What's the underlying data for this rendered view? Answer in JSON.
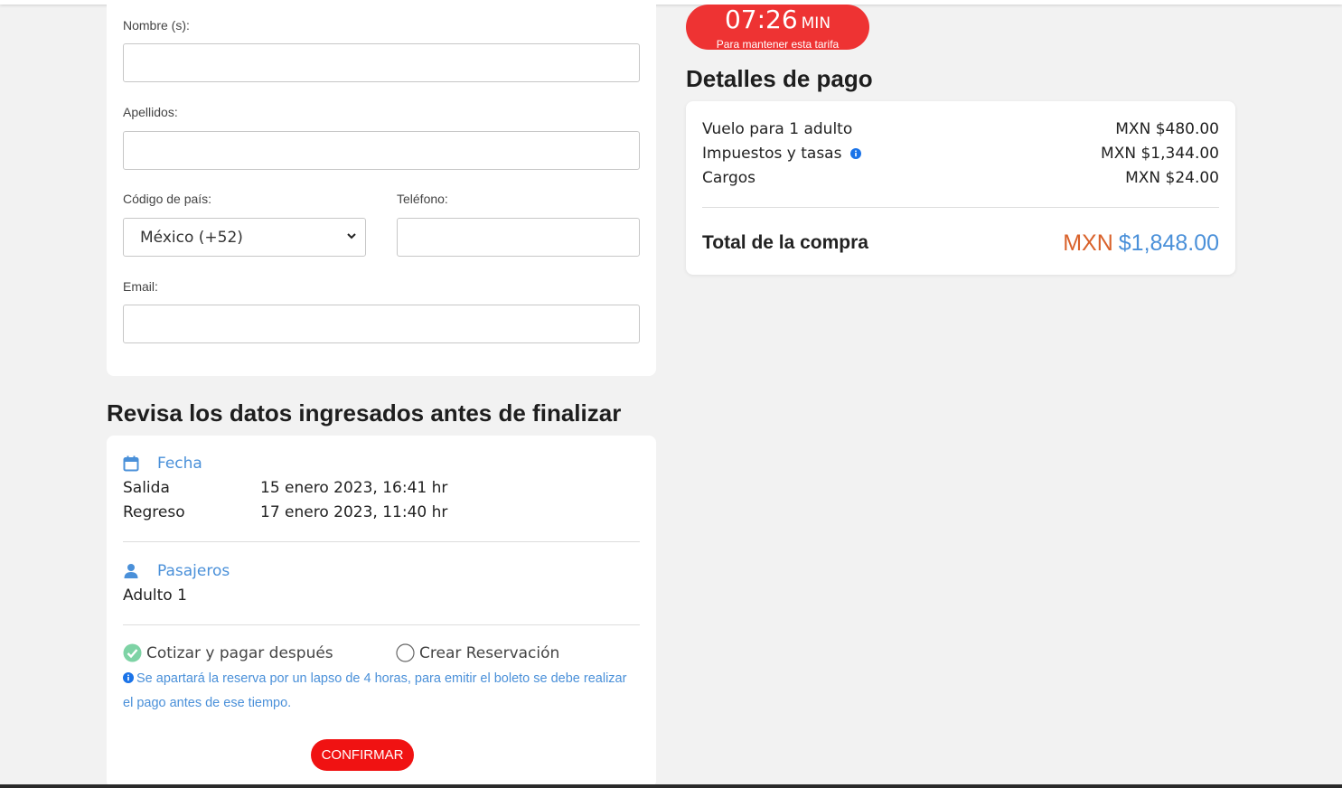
{
  "timer": {
    "time": "07:26",
    "unit": "MIN",
    "note": "Para mantener esta tarifa",
    "color": "#ee3333"
  },
  "form": {
    "nombre_label": "Nombre (s):",
    "nombre_value": "",
    "apellidos_label": "Apellidos:",
    "apellidos_value": "",
    "codigo_pais_label": "Código de país:",
    "codigo_pais_selected": "México (+52)",
    "telefono_label": "Teléfono:",
    "telefono_value": "",
    "email_label": "Email:",
    "email_value": ""
  },
  "payment": {
    "title": "Detalles de pago",
    "rows": [
      {
        "label": "Vuelo para 1 adulto",
        "amount": "MXN $480.00"
      },
      {
        "label": "Impuestos y tasas",
        "amount": "MXN $1,344.00",
        "icon": "info-icon"
      },
      {
        "label": "Cargos",
        "amount": "MXN $24.00"
      }
    ],
    "total_label": "Total de la compra",
    "total_currency": "MXN",
    "total_amount": "$1,848.00",
    "currency_color": "#d9622b",
    "amount_color": "#4a90d9"
  },
  "review": {
    "title": "Revisa los datos ingresados antes de finalizar",
    "fecha": {
      "heading": "Fecha",
      "icon": "calendar-icon",
      "salida_label": "Salida",
      "salida_value": "15 enero 2023, 16:41 hr",
      "regreso_label": "Regreso",
      "regreso_value": "17 enero 2023, 11:40 hr"
    },
    "pasajeros": {
      "heading": "Pasajeros",
      "icon": "user-icon",
      "items": [
        "Adulto 1"
      ]
    },
    "options": [
      {
        "label": "Cotizar y pagar después",
        "checked": true
      },
      {
        "label": "Crear Reservación",
        "checked": false
      }
    ],
    "note": "Se apartará la reserva por un lapso de 4 horas, para emitir el boleto se debe realizar el pago antes de ese tiempo.",
    "confirm_label": "CONFIRMAR",
    "accent_color": "#4a90d9"
  }
}
